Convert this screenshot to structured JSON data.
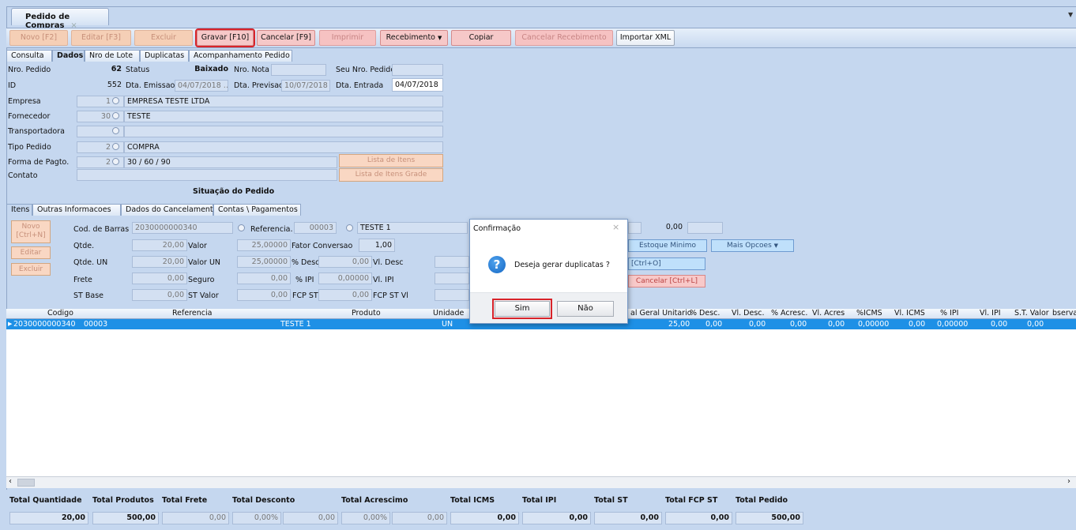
{
  "window": {
    "tab_title": "Pedido de Compras",
    "tab_close": "×"
  },
  "toolbar": {
    "novo": "Novo [F2]",
    "editar": "Editar [F3]",
    "excluir": "Excluir",
    "gravar": "Gravar [F10]",
    "cancelar": "Cancelar [F9]",
    "imprimir": "Imprimir",
    "recebimento": "Recebimento",
    "copiar": "Copiar",
    "cancelar_recebimento": "Cancelar Recebimento",
    "importar_xml": "Importar XML"
  },
  "tabs": [
    "Consulta",
    "Dados",
    "Nro de Lote",
    "Duplicatas",
    "Acompanhamento Pedido"
  ],
  "form": {
    "nro_pedido_label": "Nro. Pedido",
    "nro_pedido": "62",
    "status_label": "Status",
    "status": "Baixado",
    "nro_nota_label": "Nro. Nota",
    "nro_nota": "",
    "seu_nro_label": "Seu Nro. Pedido",
    "seu_nro": "",
    "id_label": "ID",
    "id": "552",
    "dta_emissao_label": "Dta. Emissao",
    "dta_emissao": "04/07/2018",
    "dta_previsao_label": "Dta. Previsao",
    "dta_previsao": "10/07/2018",
    "dta_entrada_label": "Dta. Entrada",
    "dta_entrada": "04/07/2018",
    "empresa_label": "Empresa",
    "empresa_cod": "1",
    "empresa": "EMPRESA TESTE LTDA",
    "fornecedor_label": "Fornecedor",
    "fornecedor_cod": "30",
    "fornecedor": "TESTE",
    "transportadora_label": "Transportadora",
    "tipo_pedido_label": "Tipo Pedido",
    "tipo_pedido_cod": "2",
    "tipo_pedido": "COMPRA",
    "forma_pagto_label": "Forma de Pagto.",
    "forma_pagto_cod": "2",
    "forma_pagto": "30 / 60 / 90",
    "contato_label": "Contato",
    "lista_itens": "Lista de Itens",
    "lista_itens_grade": "Lista de Itens Grade",
    "situacao": "Situação do Pedido"
  },
  "subtabs": [
    "Itens",
    "Outras Informacoes",
    "Dados do Cancelamento",
    "Contas \\ Pagamentos"
  ],
  "item": {
    "novo": "Novo",
    "novo_key": "[Ctrl+N]",
    "editar": "Editar",
    "excluir": "Excluir",
    "cod_barras_label": "Cod. de Barras",
    "cod_barras": "2030000000340",
    "referencia_label": "Referencia.",
    "referencia": "00003",
    "produto": "TESTE 1",
    "qtde_label": "Qtde.",
    "qtde": "20,00",
    "valor_label": "Valor",
    "valor": "25,00000",
    "fator_label": "Fator Conversao",
    "fator": "1,00",
    "qtde_un_label": "Qtde. UN",
    "qtde_un": "20,00",
    "valor_un_label": "Valor UN",
    "valor_un": "25,00000",
    "desc_pct_label": "% Desc",
    "desc_pct": "0,00",
    "vl_desc_label": "Vl. Desc",
    "frete_label": "Frete",
    "frete": "0,00",
    "seguro_label": "Seguro",
    "seguro": "0,00",
    "ipi_pct_label": "% IPI",
    "ipi_pct": "0,00000",
    "vl_ipi_label": "Vl. IPI",
    "st_base_label": "ST Base",
    "st_base": "0,00",
    "st_valor_label": "ST Valor",
    "st_valor": "0,00",
    "fcp_bc_label": "FCP ST Bc",
    "fcp_bc": "0,00",
    "fcp_vl_label": "FCP ST Vl",
    "right_value": "0,00",
    "estoque_minimo": "Estoque Minimo",
    "mais_opcoes": "Mais Opcoes",
    "ctrl_o": "[Ctrl+O]",
    "cancelar_ctrl_l": "Cancelar [Ctrl+L]"
  },
  "grid": {
    "headers": [
      "Codigo",
      "Referencia",
      "Produto",
      "Unidade",
      "al Geral Unitario",
      "% Desc.",
      "Vl. Desc.",
      "% Acresc.",
      "Vl. Acres",
      "%ICMS",
      "Vl. ICMS",
      "% IPI",
      "Vl. IPI",
      "S.T. Valor",
      "bserva"
    ],
    "row": [
      "2030000000340",
      "00003",
      "TESTE 1",
      "UN",
      "25,00",
      "0,00",
      "0,00",
      "0,00",
      "0,00",
      "0,00000",
      "0,00",
      "0,00000",
      "0,00",
      "0,00"
    ]
  },
  "footer": {
    "labels": [
      "Total Quantidade",
      "Total Produtos",
      "Total Frete",
      "Total Desconto",
      "Total Acrescimo",
      "Total ICMS",
      "Total IPI",
      "Total ST",
      "Total FCP ST",
      "Total Pedido"
    ],
    "values": [
      "20,00",
      "500,00",
      "0,00",
      "0,00%",
      "0,00",
      "0,00%",
      "0,00",
      "0,00",
      "0,00",
      "0,00",
      "0,00",
      "500,00"
    ]
  },
  "dialog": {
    "title": "Confirmação",
    "close": "×",
    "icon": "?",
    "message": "Deseja gerar duplicatas ?",
    "sim": "Sim",
    "nao": "Não"
  }
}
